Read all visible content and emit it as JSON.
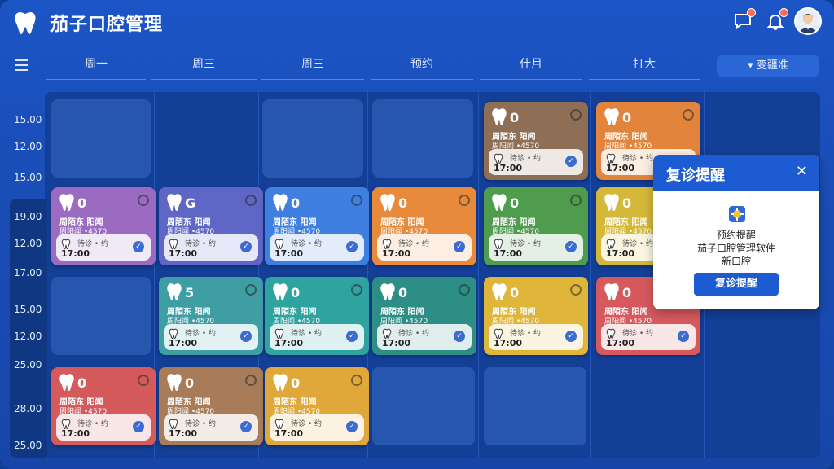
{
  "header": {
    "app_title": "茄子口腔管理",
    "icons": [
      "tooth-logo-icon",
      "message-icon",
      "bell-icon",
      "user-avatar"
    ]
  },
  "toolbar": {
    "days": [
      "周一",
      "周三",
      "周三",
      "预约",
      "什月",
      "打大"
    ],
    "filter_label": "▾ 变疆准"
  },
  "times": [
    "15.00",
    "12.00",
    "15.00",
    "19.00",
    "12.00",
    "17.00",
    "15.00",
    "12.00",
    "25.00",
    "28.00",
    "25.00"
  ],
  "card_template": {
    "name": "周陌东 阳闻",
    "sub": "周阳闻 •4570",
    "status": "待诊 • 约",
    "time": "17:00"
  },
  "cards": [
    {
      "num": "0",
      "color": "#8e6f55"
    },
    {
      "num": "0",
      "color": "#e3843c"
    },
    {
      "num": "0",
      "color": "#9b6bc2"
    },
    {
      "num": "G",
      "color": "#5e67c6"
    },
    {
      "num": "0",
      "color": "#3f7fe0"
    },
    {
      "num": "0",
      "color": "#e88a3c"
    },
    {
      "num": "0",
      "color": "#4f9c4e"
    },
    {
      "num": "0",
      "color": "#d4b83a"
    },
    {
      "num": "5",
      "color": "#3f9ea4"
    },
    {
      "num": "0",
      "color": "#2fa3a0"
    },
    {
      "num": "0",
      "color": "#2c8e84"
    },
    {
      "num": "0",
      "color": "#dfb53a"
    },
    {
      "num": "0",
      "color": "#d65a5d"
    },
    {
      "num": "0",
      "color": "#d45a5c"
    },
    {
      "num": "0",
      "color": "#a87c58"
    },
    {
      "num": "0",
      "color": "#e0a83a"
    }
  ],
  "popup": {
    "title": "复诊提醒",
    "close": "✕",
    "line1": "预约提醒",
    "line2": "茄子口腔管理软件",
    "line3": "新口腔",
    "button": "复诊提醒"
  }
}
